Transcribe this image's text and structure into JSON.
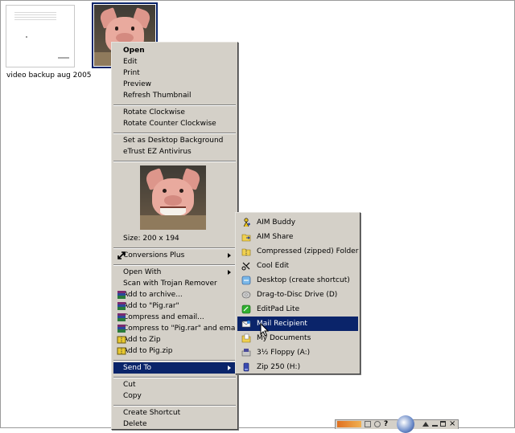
{
  "files": [
    {
      "name": "video backup aug 2005"
    },
    {
      "name": "Pig"
    }
  ],
  "context_menu": {
    "group1": [
      "Open",
      "Edit",
      "Print",
      "Preview",
      "Refresh Thumbnail"
    ],
    "group2": [
      "Rotate Clockwise",
      "Rotate Counter Clockwise"
    ],
    "group3": [
      "Set as Desktop Background",
      "eTrust EZ Antivirus"
    ],
    "preview_size": "Size: 200 x 194",
    "conversions_plus": "Conversions Plus",
    "group5": [
      "Open With",
      "Scan with Trojan Remover",
      "Add to archive...",
      "Add to \"Pig.rar\"",
      "Compress and email...",
      "Compress to \"Pig.rar\" and email",
      "Add to Zip",
      "Add to Pig.zip"
    ],
    "send_to": "Send To",
    "group7": [
      "Cut",
      "Copy"
    ],
    "group8": [
      "Create Shortcut",
      "Delete"
    ]
  },
  "send_to_menu": [
    {
      "label": "AIM Buddy",
      "icon": "aim-buddy-icon"
    },
    {
      "label": "AIM Share",
      "icon": "aim-share-icon"
    },
    {
      "label": "Compressed (zipped) Folder",
      "icon": "zip-folder-icon"
    },
    {
      "label": "Cool Edit",
      "icon": "cool-edit-icon"
    },
    {
      "label": "Desktop (create shortcut)",
      "icon": "desktop-icon"
    },
    {
      "label": "Drag-to-Disc Drive (D)",
      "icon": "disc-drive-icon"
    },
    {
      "label": "EditPad Lite",
      "icon": "editpad-icon"
    },
    {
      "label": "Mail Recipient",
      "icon": "mail-icon"
    },
    {
      "label": "My Documents",
      "icon": "my-documents-icon"
    },
    {
      "label": "3½ Floppy (A:)",
      "icon": "floppy-icon"
    },
    {
      "label": "Zip 250  (H:)",
      "icon": "zip-drive-icon"
    }
  ],
  "colors": {
    "highlight": "#0a246a",
    "menu_bg": "#d4d0c8"
  }
}
